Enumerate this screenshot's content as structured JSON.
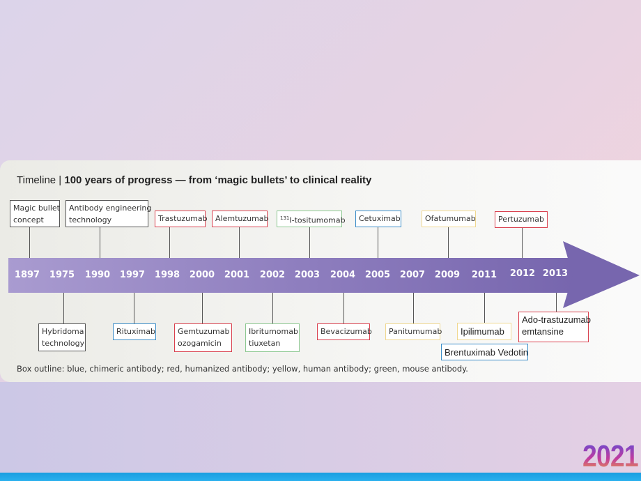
{
  "title": {
    "prefix": "Timeline",
    "main": "100 years of progress — from ‘magic bullets’ to clinical reality"
  },
  "years": [
    "1897",
    "1975",
    "1990",
    "1997",
    "1998",
    "2000",
    "2001",
    "2002",
    "2003",
    "2004",
    "2005",
    "2007",
    "2009",
    "2011",
    "2012",
    "2013"
  ],
  "top_boxes": [
    {
      "line1": "Magic bullet",
      "line2": "concept",
      "outline": "none"
    },
    {
      "line1": "Antibody engineering",
      "line2": "technology",
      "outline": "none"
    },
    {
      "line1": "Trastuzumab",
      "outline": "red"
    },
    {
      "line1": "Alemtuzumab",
      "outline": "red"
    },
    {
      "sup": "131",
      "line1": "I-tositumomab",
      "outline": "green"
    },
    {
      "line1": "Cetuximab",
      "outline": "blue"
    },
    {
      "line1": "Ofatumumab",
      "outline": "yellow"
    },
    {
      "line1": "Pertuzumab",
      "outline": "red"
    }
  ],
  "bottom_boxes": [
    {
      "line1": "Hybridoma",
      "line2": "technology",
      "outline": "none"
    },
    {
      "line1": "Rituximab",
      "outline": "blue"
    },
    {
      "line1": "Gemtuzumab",
      "line2": "ozogamicin",
      "outline": "red"
    },
    {
      "line1": "Ibritumomab",
      "line2": "tiuxetan",
      "outline": "green"
    },
    {
      "line1": "Bevacizumab",
      "outline": "red"
    },
    {
      "line1": "Panitumumab",
      "outline": "yellow"
    },
    {
      "line1": "Ipilimumab",
      "outline": "yellow"
    },
    {
      "line1": "Brentuximab Vedotin",
      "outline": "blue"
    },
    {
      "line1": "Ado-trastuzumab",
      "line2": "emtansine",
      "outline": "red"
    }
  ],
  "legend": "Box outline: blue, chimeric antibody; red, humanized antibody; yellow, human antibody; green, mouse antibody.",
  "logo_year": "2021",
  "colors": {
    "red": "#d9404e",
    "blue": "#3a8cc8",
    "yellow": "#f0d890",
    "green": "#8cc890",
    "arrow": "#7766ae"
  }
}
